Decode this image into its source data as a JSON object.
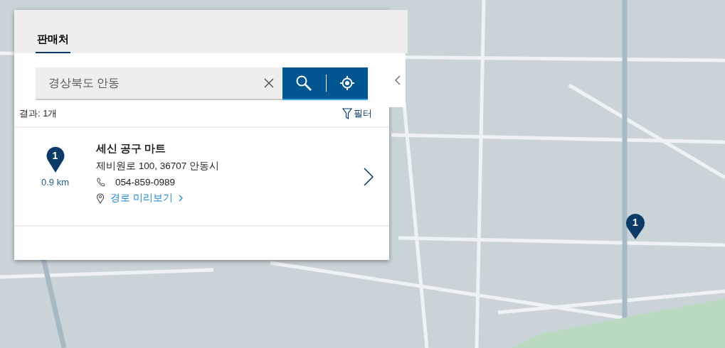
{
  "tabs": [
    {
      "label": "판매처",
      "selected": true
    }
  ],
  "search": {
    "value": "경상북도 안동"
  },
  "results_count": "결과: 1개",
  "filter_label": "필터",
  "results": [
    {
      "marker": "1",
      "distance": "0.9 km",
      "name": "세신 공구 마트",
      "address": "제비원로 100, 36707 안동시",
      "phone": "054-859-0989",
      "route_link": "경로 미리보기"
    }
  ],
  "map": {
    "pins": [
      {
        "label": "1"
      }
    ]
  }
}
